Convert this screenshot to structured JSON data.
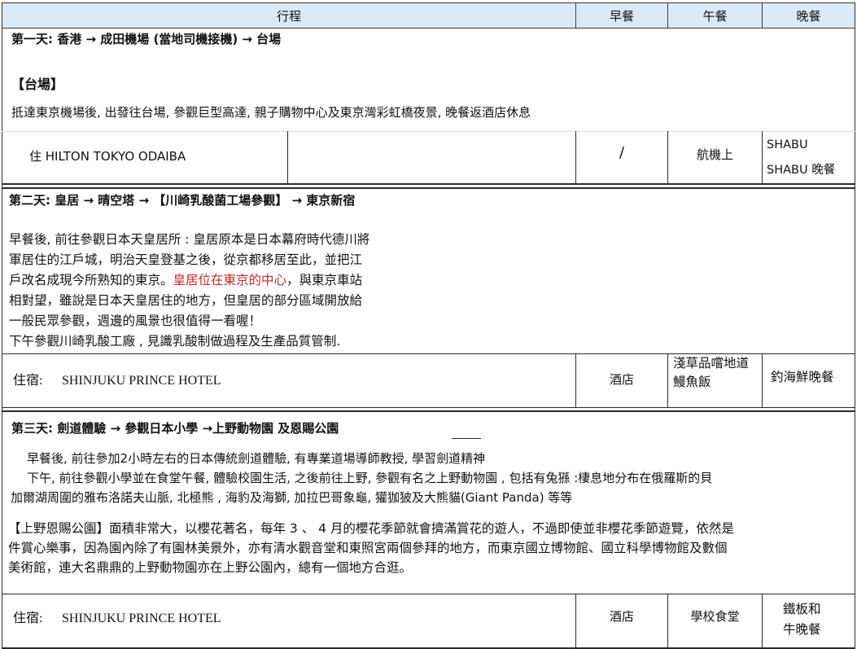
{
  "header": {
    "itinerary": "行程",
    "breakfast": "早餐",
    "lunch": "午餐",
    "dinner": "晚餐"
  },
  "day1": {
    "title": "第一天:  香港 →  成田機場  (當地司機接機)  →  台場",
    "section": "【台場】",
    "desc": "抵達東京機場後, 出發往台場, 參觀巨型高達, 親子購物中心及東京灣彩虹橋夜景, 晚餐返酒店休息",
    "hotel": "住 HILTON TOKYO ODAIBA",
    "breakfast": "/",
    "lunch": "航機上",
    "dinner_line1": "SHABU",
    "dinner_line2": "SHABU 晚餐"
  },
  "day2": {
    "title": "第二天:   皇居 →     晴空塔     →    【川崎乳酸菌工場參觀】 → 東京新宿",
    "p_line1": "早餐後, 前往參觀日本天皇居所 : 皇居原本是日本幕府時代德川將",
    "p_line2": "軍居住的江戶城，明治天皇登基之後，從京都移居至此，並把江",
    "p_line3a": "戶改名成現今所熟知的東京。",
    "p_line3_red": "皇居位在東京的中心",
    "p_line3b": "，與東京車站",
    "p_line4": "相對望，雖說是日本天皇居住的地方，但皇居的部分區域開放給",
    "p_line5": "一般民眾參觀，週邊的風景也很值得一看喔！",
    "p_line6": "下午參觀川崎乳酸工廠 , 見識乳酸制做過程及生產品質管制.",
    "hotel_label": "住宿:",
    "hotel_name": "SHINJUKU PRINCE HOTEL",
    "breakfast": "酒店",
    "lunch_line1": "淺草品嚐地道",
    "lunch_line2": "鰻魚飯",
    "dinner": "釣海鮮晚餐"
  },
  "day3": {
    "title": "第三天:  劍道體驗  → 參觀日本小學 →上野動物園 及恩賜公園",
    "p1": "早餐後, 前往參加2小時左右的日本傳統劍道體驗, 有專業道場導師教授, 學習劍道精神",
    "p2_line1": "下午, 前往參觀小學並在食堂午餐, 體驗校園生活, 之後前往上野, 參觀有名之上野動物園 , 包括有兔猻 :棲息地分布在俄羅斯的貝",
    "p2_line2": "加爾湖周圍的雅布洛諾夫山脈, 北極熊 , 海豹及海獅, 加拉巴哥象龜, 獾㹢狓及大熊貓(Giant Panda) 等等",
    "p3_line1": "【上野恩賜公園】面積非常大，以櫻花著名，每年 3 、 4 月的櫻花季節就會擠滿賞花的遊人，不過即使並非櫻花季節遊覽，依然是",
    "p3_line2": "件賞心樂事，因為園內除了有園林美景外，亦有清水觀音堂和東照宮兩個參拜的地方，而東京國立博物館、國立科學博物館及數個",
    "p3_line3": "美術館，連大名鼎鼎的上野動物園亦在上野公園內，總有一個地方合逛。",
    "hotel_label": "住宿:",
    "hotel_name": "SHINJUKU PRINCE HOTEL",
    "breakfast": "酒店",
    "lunch": "學校食堂",
    "dinner_line1": "鐵板和",
    "dinner_line2": "牛晚餐"
  }
}
